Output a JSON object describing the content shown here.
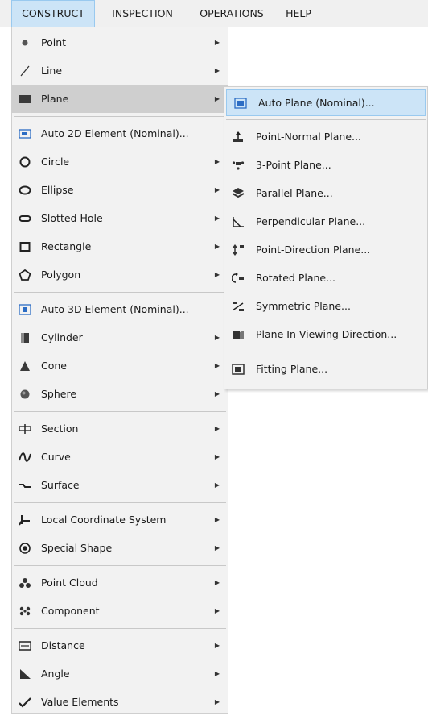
{
  "menubar": {
    "items": [
      {
        "label": "CONSTRUCT"
      },
      {
        "label": "INSPECTION"
      },
      {
        "label": "OPERATIONS"
      },
      {
        "label": "HELP"
      }
    ]
  },
  "construct_menu": {
    "items": [
      {
        "label": "Point",
        "icon": "point-dot-icon",
        "has_submenu": true
      },
      {
        "label": "Line",
        "icon": "line-icon",
        "has_submenu": true
      },
      {
        "label": "Plane",
        "icon": "plane-icon",
        "has_submenu": true,
        "highlighted": true
      },
      {
        "label": "Auto 2D Element (Nominal)...",
        "icon": "auto-2d-element-icon",
        "has_submenu": false
      },
      {
        "label": "Circle",
        "icon": "circle-icon",
        "has_submenu": true
      },
      {
        "label": "Ellipse",
        "icon": "ellipse-icon",
        "has_submenu": true
      },
      {
        "label": "Slotted Hole",
        "icon": "slotted-hole-icon",
        "has_submenu": true
      },
      {
        "label": "Rectangle",
        "icon": "rectangle-icon",
        "has_submenu": true
      },
      {
        "label": "Polygon",
        "icon": "polygon-icon",
        "has_submenu": true
      },
      {
        "label": "Auto 3D Element (Nominal)...",
        "icon": "auto-3d-element-icon",
        "has_submenu": false
      },
      {
        "label": "Cylinder",
        "icon": "cylinder-icon",
        "has_submenu": true
      },
      {
        "label": "Cone",
        "icon": "cone-icon",
        "has_submenu": true
      },
      {
        "label": "Sphere",
        "icon": "sphere-icon",
        "has_submenu": true
      },
      {
        "label": "Section",
        "icon": "section-icon",
        "has_submenu": true
      },
      {
        "label": "Curve",
        "icon": "curve-icon",
        "has_submenu": true
      },
      {
        "label": "Surface",
        "icon": "surface-icon",
        "has_submenu": true
      },
      {
        "label": "Local Coordinate System",
        "icon": "coordinate-system-icon",
        "has_submenu": true
      },
      {
        "label": "Special Shape",
        "icon": "special-shape-icon",
        "has_submenu": true
      },
      {
        "label": "Point Cloud",
        "icon": "point-cloud-icon",
        "has_submenu": true
      },
      {
        "label": "Component",
        "icon": "component-icon",
        "has_submenu": true
      },
      {
        "label": "Distance",
        "icon": "distance-icon",
        "has_submenu": true
      },
      {
        "label": "Angle",
        "icon": "angle-icon",
        "has_submenu": true
      },
      {
        "label": "Value Elements",
        "icon": "value-elements-icon",
        "has_submenu": true
      }
    ]
  },
  "plane_submenu": {
    "items": [
      {
        "label": "Auto Plane (Nominal)...",
        "icon": "auto-plane-icon",
        "highlighted": true
      },
      {
        "label": "Point-Normal Plane...",
        "icon": "point-normal-plane-icon"
      },
      {
        "label": "3-Point Plane...",
        "icon": "three-point-plane-icon"
      },
      {
        "label": "Parallel Plane...",
        "icon": "parallel-plane-icon"
      },
      {
        "label": "Perpendicular Plane...",
        "icon": "perpendicular-plane-icon"
      },
      {
        "label": "Point-Direction Plane...",
        "icon": "point-direction-plane-icon"
      },
      {
        "label": "Rotated Plane...",
        "icon": "rotated-plane-icon"
      },
      {
        "label": "Symmetric Plane...",
        "icon": "symmetric-plane-icon"
      },
      {
        "label": "Plane In Viewing Direction...",
        "icon": "viewing-direction-plane-icon"
      },
      {
        "label": "Fitting Plane...",
        "icon": "fitting-plane-icon"
      }
    ]
  },
  "colors": {
    "menubar_bg": "#f0f0f0",
    "menu_bg": "#f2f2f2",
    "active_menu_bg": "#cce4f7",
    "hover_gray": "#cfcfcf",
    "icon_blue": "#2b6cc4"
  }
}
